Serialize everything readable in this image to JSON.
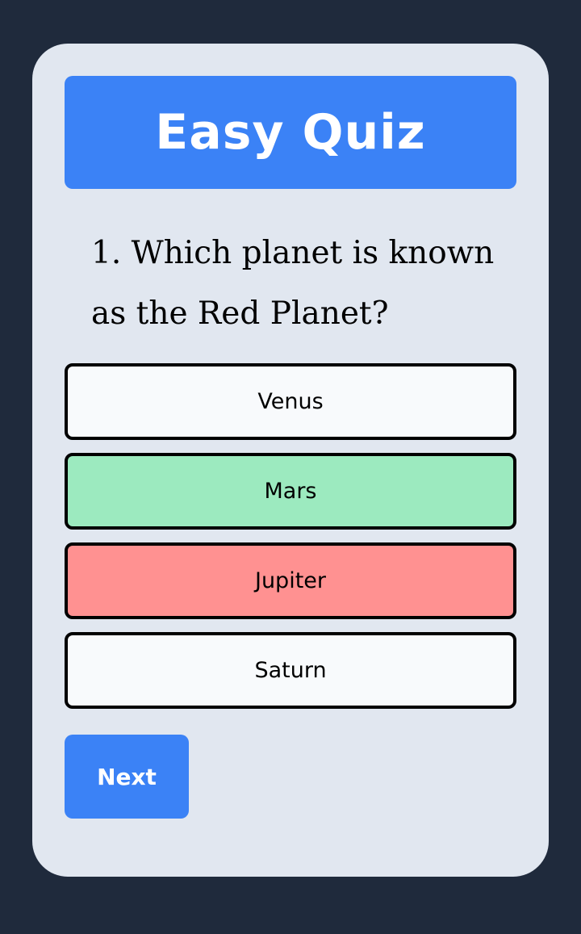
{
  "quiz": {
    "title": "Easy Quiz",
    "question_number": "1.",
    "question_text": "1. Which planet is known as the Red Planet?",
    "answers": [
      {
        "label": "Venus",
        "state": "neutral",
        "color": "#f8fafc"
      },
      {
        "label": "Mars",
        "state": "correct",
        "color": "#9ceabf"
      },
      {
        "label": "Jupiter",
        "state": "wrong",
        "color": "#ff9191"
      },
      {
        "label": "Saturn",
        "state": "neutral",
        "color": "#f8fafc"
      }
    ],
    "next_label": "Next"
  },
  "colors": {
    "background": "#1f2a3c",
    "card": "#e1e7f0",
    "accent": "#3b82f6"
  }
}
